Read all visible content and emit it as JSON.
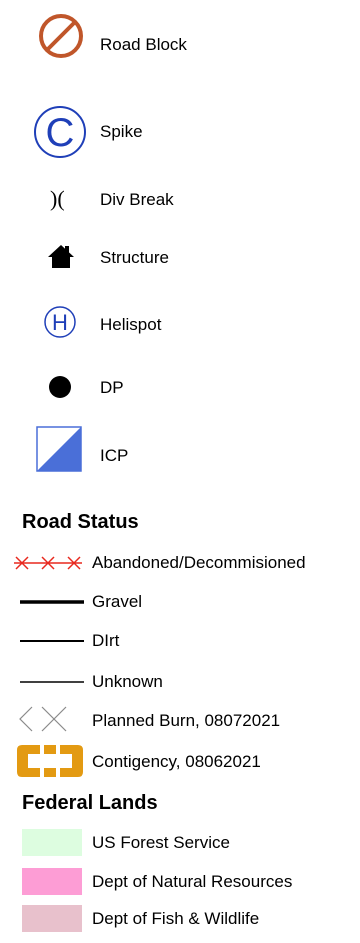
{
  "symbols": [
    {
      "label": "Road Block",
      "icon": "road-block-icon",
      "color": "#c0562a"
    },
    {
      "label": "Spike",
      "icon": "spike-icon",
      "color": "#1f3fb8"
    },
    {
      "label": "Div Break",
      "icon": "div-break-icon",
      "color": "#000000"
    },
    {
      "label": "Structure",
      "icon": "structure-icon",
      "color": "#000000"
    },
    {
      "label": "Helispot",
      "icon": "helispot-icon",
      "color": "#1f3fb8"
    },
    {
      "label": "DP",
      "icon": "dp-icon",
      "color": "#000000"
    },
    {
      "label": "ICP",
      "icon": "icp-icon",
      "color": "#4a6fd8"
    }
  ],
  "road_status": {
    "heading": "Road Status",
    "items": [
      {
        "label": "Abandoned/Decommisioned",
        "icon": "abandoned-road-icon",
        "color": "#e8281e"
      },
      {
        "label": "Gravel",
        "icon": "gravel-road-icon",
        "color": "#000000"
      },
      {
        "label": "DIrt",
        "icon": "dirt-road-icon",
        "color": "#000000"
      },
      {
        "label": "Unknown",
        "icon": "unknown-road-icon",
        "color": "#000000"
      },
      {
        "label": "Planned Burn, 08072021",
        "icon": "planned-burn-icon",
        "color": "#8a8a8a"
      },
      {
        "label": "Contigency, 08062021",
        "icon": "contingency-icon",
        "color": "#e39a12"
      }
    ]
  },
  "federal_lands": {
    "heading": "Federal Lands",
    "items": [
      {
        "label": "US Forest Service",
        "color": "#ddfde0"
      },
      {
        "label": "Dept of Natural Resources",
        "color": "#fd9dd5"
      },
      {
        "label": "Dept of Fish & Wildlife",
        "color": "#e8c1cc"
      }
    ]
  }
}
